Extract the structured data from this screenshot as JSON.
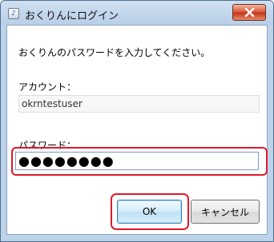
{
  "window": {
    "title": "おくりんにログイン",
    "app_icon_glyph": "♪",
    "close_icon": "close-icon"
  },
  "dialog": {
    "message": "おくりんのパスワードを入力してください。",
    "account_label": "アカウント：",
    "account_value": "okrntestuser",
    "password_label": "パスワード：",
    "password_masked": "●●●●●●●●"
  },
  "buttons": {
    "ok_label": "OK",
    "cancel_label": "キャンセル"
  },
  "colors": {
    "highlight": "#e0182c",
    "title_bar": "#bcd3ea",
    "close_button": "#c53317"
  }
}
